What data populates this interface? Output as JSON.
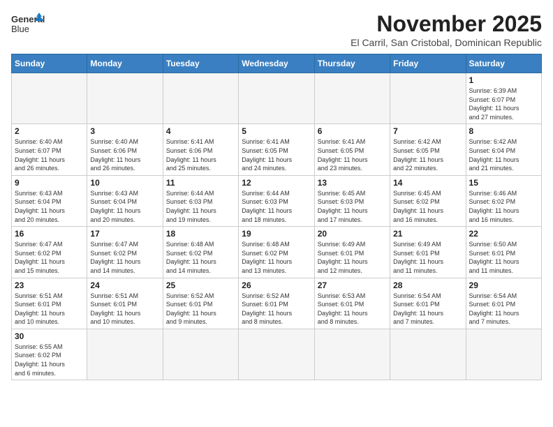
{
  "header": {
    "logo_line1": "General",
    "logo_line2": "Blue",
    "month": "November 2025",
    "location": "El Carril, San Cristobal, Dominican Republic"
  },
  "weekdays": [
    "Sunday",
    "Monday",
    "Tuesday",
    "Wednesday",
    "Thursday",
    "Friday",
    "Saturday"
  ],
  "weeks": [
    [
      {
        "day": "",
        "info": ""
      },
      {
        "day": "",
        "info": ""
      },
      {
        "day": "",
        "info": ""
      },
      {
        "day": "",
        "info": ""
      },
      {
        "day": "",
        "info": ""
      },
      {
        "day": "",
        "info": ""
      },
      {
        "day": "1",
        "info": "Sunrise: 6:39 AM\nSunset: 6:07 PM\nDaylight: 11 hours\nand 27 minutes."
      }
    ],
    [
      {
        "day": "2",
        "info": "Sunrise: 6:40 AM\nSunset: 6:07 PM\nDaylight: 11 hours\nand 26 minutes."
      },
      {
        "day": "3",
        "info": "Sunrise: 6:40 AM\nSunset: 6:06 PM\nDaylight: 11 hours\nand 26 minutes."
      },
      {
        "day": "4",
        "info": "Sunrise: 6:41 AM\nSunset: 6:06 PM\nDaylight: 11 hours\nand 25 minutes."
      },
      {
        "day": "5",
        "info": "Sunrise: 6:41 AM\nSunset: 6:05 PM\nDaylight: 11 hours\nand 24 minutes."
      },
      {
        "day": "6",
        "info": "Sunrise: 6:41 AM\nSunset: 6:05 PM\nDaylight: 11 hours\nand 23 minutes."
      },
      {
        "day": "7",
        "info": "Sunrise: 6:42 AM\nSunset: 6:05 PM\nDaylight: 11 hours\nand 22 minutes."
      },
      {
        "day": "8",
        "info": "Sunrise: 6:42 AM\nSunset: 6:04 PM\nDaylight: 11 hours\nand 21 minutes."
      }
    ],
    [
      {
        "day": "9",
        "info": "Sunrise: 6:43 AM\nSunset: 6:04 PM\nDaylight: 11 hours\nand 20 minutes."
      },
      {
        "day": "10",
        "info": "Sunrise: 6:43 AM\nSunset: 6:04 PM\nDaylight: 11 hours\nand 20 minutes."
      },
      {
        "day": "11",
        "info": "Sunrise: 6:44 AM\nSunset: 6:03 PM\nDaylight: 11 hours\nand 19 minutes."
      },
      {
        "day": "12",
        "info": "Sunrise: 6:44 AM\nSunset: 6:03 PM\nDaylight: 11 hours\nand 18 minutes."
      },
      {
        "day": "13",
        "info": "Sunrise: 6:45 AM\nSunset: 6:03 PM\nDaylight: 11 hours\nand 17 minutes."
      },
      {
        "day": "14",
        "info": "Sunrise: 6:45 AM\nSunset: 6:02 PM\nDaylight: 11 hours\nand 16 minutes."
      },
      {
        "day": "15",
        "info": "Sunrise: 6:46 AM\nSunset: 6:02 PM\nDaylight: 11 hours\nand 16 minutes."
      }
    ],
    [
      {
        "day": "16",
        "info": "Sunrise: 6:47 AM\nSunset: 6:02 PM\nDaylight: 11 hours\nand 15 minutes."
      },
      {
        "day": "17",
        "info": "Sunrise: 6:47 AM\nSunset: 6:02 PM\nDaylight: 11 hours\nand 14 minutes."
      },
      {
        "day": "18",
        "info": "Sunrise: 6:48 AM\nSunset: 6:02 PM\nDaylight: 11 hours\nand 14 minutes."
      },
      {
        "day": "19",
        "info": "Sunrise: 6:48 AM\nSunset: 6:02 PM\nDaylight: 11 hours\nand 13 minutes."
      },
      {
        "day": "20",
        "info": "Sunrise: 6:49 AM\nSunset: 6:01 PM\nDaylight: 11 hours\nand 12 minutes."
      },
      {
        "day": "21",
        "info": "Sunrise: 6:49 AM\nSunset: 6:01 PM\nDaylight: 11 hours\nand 11 minutes."
      },
      {
        "day": "22",
        "info": "Sunrise: 6:50 AM\nSunset: 6:01 PM\nDaylight: 11 hours\nand 11 minutes."
      }
    ],
    [
      {
        "day": "23",
        "info": "Sunrise: 6:51 AM\nSunset: 6:01 PM\nDaylight: 11 hours\nand 10 minutes."
      },
      {
        "day": "24",
        "info": "Sunrise: 6:51 AM\nSunset: 6:01 PM\nDaylight: 11 hours\nand 10 minutes."
      },
      {
        "day": "25",
        "info": "Sunrise: 6:52 AM\nSunset: 6:01 PM\nDaylight: 11 hours\nand 9 minutes."
      },
      {
        "day": "26",
        "info": "Sunrise: 6:52 AM\nSunset: 6:01 PM\nDaylight: 11 hours\nand 8 minutes."
      },
      {
        "day": "27",
        "info": "Sunrise: 6:53 AM\nSunset: 6:01 PM\nDaylight: 11 hours\nand 8 minutes."
      },
      {
        "day": "28",
        "info": "Sunrise: 6:54 AM\nSunset: 6:01 PM\nDaylight: 11 hours\nand 7 minutes."
      },
      {
        "day": "29",
        "info": "Sunrise: 6:54 AM\nSunset: 6:01 PM\nDaylight: 11 hours\nand 7 minutes."
      }
    ],
    [
      {
        "day": "30",
        "info": "Sunrise: 6:55 AM\nSunset: 6:02 PM\nDaylight: 11 hours\nand 6 minutes."
      },
      {
        "day": "",
        "info": ""
      },
      {
        "day": "",
        "info": ""
      },
      {
        "day": "",
        "info": ""
      },
      {
        "day": "",
        "info": ""
      },
      {
        "day": "",
        "info": ""
      },
      {
        "day": "",
        "info": ""
      }
    ]
  ]
}
